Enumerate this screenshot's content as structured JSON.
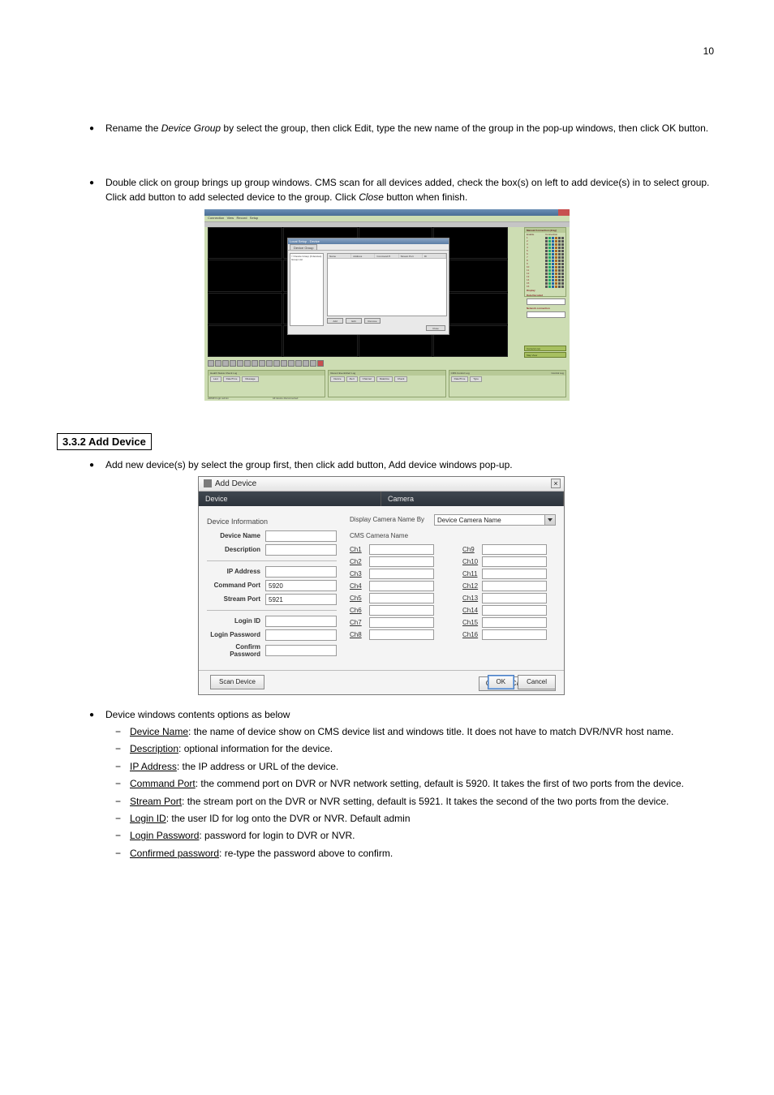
{
  "page_number": "10",
  "bullets": {
    "b1_prefix": "Rename the ",
    "b1_em": "Device Group",
    "b1_rest": " by select the group, then click Edit, type the new name of the group in the pop-up windows, then click OK button.",
    "b2_prefix": "Double click on group brings up group windows. CMS scan for all devices added, check the box(s) on left to add device(s) in to select group. Click add button to add selected device to the group. Click ",
    "b2_em": "Close",
    "b2_rest": " button when finish."
  },
  "screenshot1": {
    "dialog_title": "Local Setup - Device",
    "dialog_tab": "Device Group",
    "left_items": [
      "☐ Device Group (0 devices)",
      "  Group List"
    ],
    "headers": [
      "Name",
      "Address",
      "Command P.",
      "Stream Port",
      "ID"
    ],
    "buttons": {
      "add": "Add",
      "edit": "Edit",
      "remove": "Remove",
      "close": "Close"
    },
    "right_panel_title": "Manual Connection (drag)",
    "right_panel_cols": [
      "Enable",
      "Connection"
    ],
    "rows": [
      "1",
      "2",
      "3",
      "4",
      "5",
      "6",
      "7",
      "8",
      "9",
      "10",
      "11",
      "12",
      "13",
      "14",
      "15",
      "16"
    ],
    "speed_label": "Display",
    "date_label": "Data Decoded",
    "net_label": "Network connection",
    "side_buttons": {
      "live": "Camera Live",
      "map": "Map View"
    },
    "bottom_panels": {
      "p1_title": "Health Status Check Log",
      "p1_tabs": [
        "Last",
        "Date/Time",
        "Message"
      ],
      "p2_title": "Recent Event/Alert Log",
      "p2_tabs": [
        "Device",
        "Alert",
        "Channel",
        "Datetime",
        "Check"
      ],
      "p3_title": "CMS Control Log",
      "p3_tabs": [
        "Date/Time",
        "Type"
      ],
      "p3_right": "Control Log"
    },
    "status_left": "ADMIN login admin",
    "status_right": "All device disconnected",
    "menu": [
      "Connection",
      "View",
      "Record",
      "Setup"
    ]
  },
  "section_header": "3.3.2 Add Device",
  "bullets2": {
    "b1": "Add new device(s) by select the group first, then click add button, Add device windows pop-up."
  },
  "screenshot2": {
    "title": "Add Device",
    "tabs": {
      "left": "Device",
      "right": "Camera"
    },
    "left_group": "Device Information",
    "fields": {
      "device_name": {
        "label": "Device Name",
        "value": ""
      },
      "description": {
        "label": "Description",
        "value": ""
      },
      "ip": {
        "label": "IP Address",
        "value": ""
      },
      "cmd_port": {
        "label": "Command Port",
        "value": "5920"
      },
      "stream_port": {
        "label": "Stream Port",
        "value": "5921"
      },
      "login_id": {
        "label": "Login ID",
        "value": ""
      },
      "login_pw": {
        "label": "Login Password",
        "value": ""
      },
      "confirm_pw": {
        "label": "Confirm Password",
        "value": ""
      }
    },
    "right": {
      "display_by_label": "Display Camera Name By",
      "display_by_value": "Device Camera Name",
      "cms_name_label": "CMS Camera Name",
      "channels_left": [
        "Ch1",
        "Ch2",
        "Ch3",
        "Ch4",
        "Ch5",
        "Ch6",
        "Ch7",
        "Ch8"
      ],
      "channels_right": [
        "Ch9",
        "Ch10",
        "Ch11",
        "Ch12",
        "Ch13",
        "Ch14",
        "Ch15",
        "Ch16"
      ]
    },
    "buttons": {
      "clear": "Clear All Camera Text",
      "scan": "Scan Device",
      "ok": "OK",
      "cancel": "Cancel"
    }
  },
  "bullets3": {
    "intro": "Device windows contents options as below",
    "items": [
      {
        "label": "Device Name",
        "rest": ": the name of device show on CMS device list and windows title. It does not have to match DVR/NVR host name."
      },
      {
        "label": "Description",
        "rest": ": optional information for the device."
      },
      {
        "label": "IP Address",
        "rest": ": the IP address or URL of the device."
      },
      {
        "label": "Command Port",
        "rest": ": the commend port on DVR or NVR network setting, default is 5920. It takes the first of two ports from the device."
      },
      {
        "label": "Stream Port",
        "rest": ": the stream port on the DVR or NVR setting, default is 5921. It takes the second of the two ports from the device."
      },
      {
        "label": "Login ID",
        "rest": ": the user ID for log onto the DVR or NVR. Default admin"
      },
      {
        "label": "Login Password",
        "rest": ": password for login to DVR or NVR."
      },
      {
        "label": "Confirmed password",
        "rest": ": re-type the password above to confirm."
      }
    ]
  }
}
